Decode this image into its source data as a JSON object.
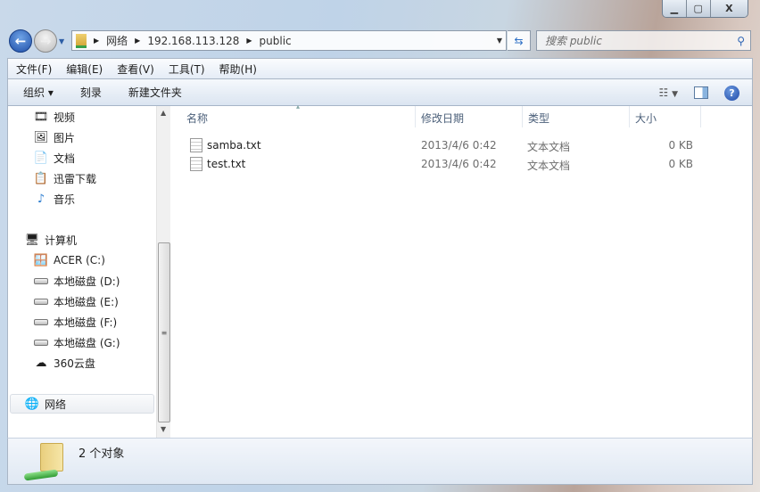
{
  "window": {
    "controls": {
      "minimize": "▁",
      "maximize": "▢",
      "close": "X"
    }
  },
  "address": {
    "crumbs": [
      "网络",
      "192.168.113.128",
      "public"
    ]
  },
  "search": {
    "placeholder": "搜索 public"
  },
  "menu": [
    "文件(F)",
    "编辑(E)",
    "查看(V)",
    "工具(T)",
    "帮助(H)"
  ],
  "toolbar": {
    "organize": "组织 ▾",
    "burn": "刻录",
    "new_folder": "新建文件夹",
    "help": "?"
  },
  "nav": {
    "libraries": [
      "视频",
      "图片",
      "文档",
      "迅雷下载",
      "音乐"
    ],
    "computer": "计算机",
    "drives": [
      "ACER (C:)",
      "本地磁盘 (D:)",
      "本地磁盘 (E:)",
      "本地磁盘 (F:)",
      "本地磁盘 (G:)",
      "360云盘"
    ],
    "network": "网络"
  },
  "columns": [
    "名称",
    "修改日期",
    "类型",
    "大小"
  ],
  "files": [
    {
      "name": "samba.txt",
      "date": "2013/4/6 0:42",
      "type": "文本文档",
      "size": "0 KB"
    },
    {
      "name": "test.txt",
      "date": "2013/4/6 0:42",
      "type": "文本文档",
      "size": "0 KB"
    }
  ],
  "status": {
    "count": "2 个对象"
  }
}
